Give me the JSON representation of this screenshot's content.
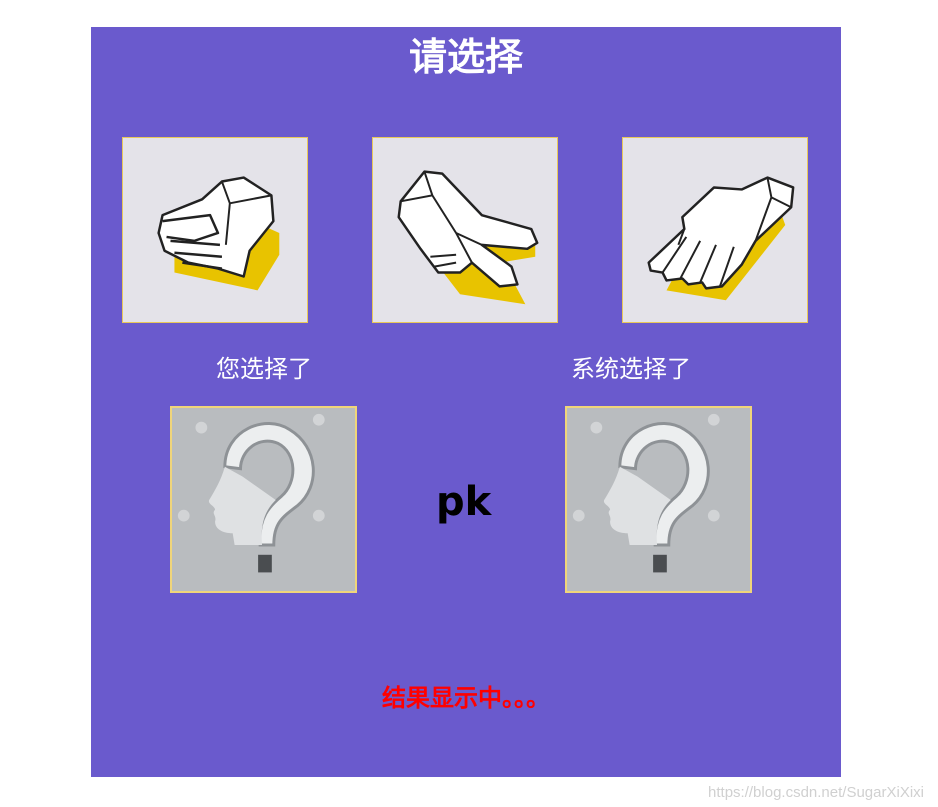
{
  "game": {
    "title": "请选择",
    "choices": [
      {
        "name": "rock",
        "icon": "fist-icon"
      },
      {
        "name": "scissors",
        "icon": "scissors-hand-icon"
      },
      {
        "name": "paper",
        "icon": "open-palm-icon"
      }
    ],
    "you_label": "您选择了",
    "system_label": "系统选择了",
    "vs_text": "pk",
    "result_text": "结果显示中。。。"
  },
  "watermark": "https://blog.csdn.net/SugarXiXixi",
  "colors": {
    "panel": "#6a5acd",
    "title": "#ffffff",
    "result": "#ff0000",
    "choice_bg": "#e4e3e9",
    "hand_shadow": "#e8c300"
  }
}
